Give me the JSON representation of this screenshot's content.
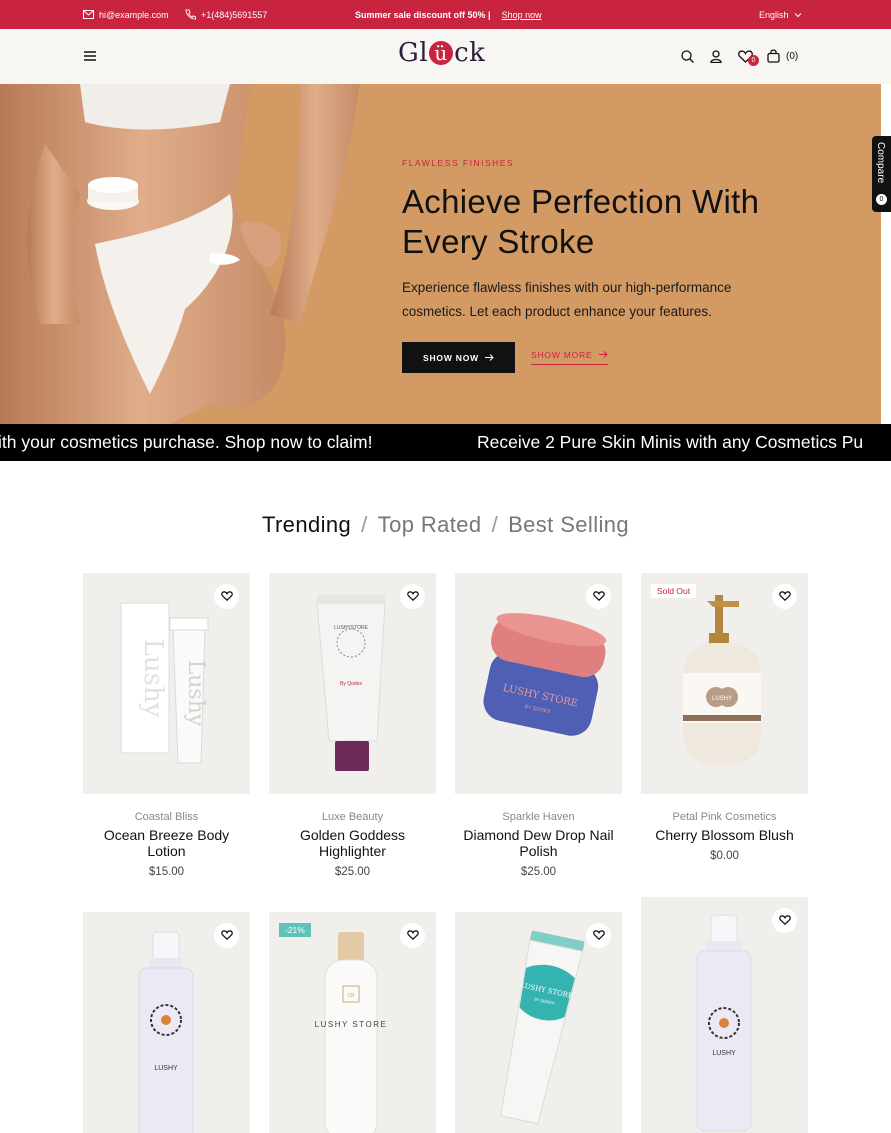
{
  "topbar": {
    "email": "hi@example.com",
    "phone": "+1(484)5691557",
    "promo": "Summer sale discount off 50% |",
    "promo_link": "Shop now",
    "language": "English"
  },
  "header": {
    "logo_left": "Gl",
    "logo_u": "ü",
    "logo_right": "ck",
    "wishlist_count": "0",
    "cart_count": "(0)"
  },
  "hero": {
    "eyebrow": "FLAWLESS FINISHES",
    "title": "Achieve Perfection With Every Stroke",
    "description": "Experience flawless finishes with our high-performance cosmetics. Let each product enhance your features.",
    "primary_button": "SHOW NOW",
    "secondary_button": "SHOW MORE"
  },
  "compare": {
    "label": "Compare",
    "count": "0"
  },
  "marquee": {
    "text_1": "ith your cosmetics purchase. Shop now to claim!",
    "text_2": "Receive 2 Pure Skin Minis with any Cosmetics Pu"
  },
  "tabs": [
    {
      "label": "Trending",
      "active": true
    },
    {
      "label": "Top Rated",
      "active": false
    },
    {
      "label": "Best Selling",
      "active": false
    }
  ],
  "products": [
    {
      "brand": "Coastal Bliss",
      "name": "Ocean Breeze Body Lotion",
      "price": "$15.00",
      "badge": ""
    },
    {
      "brand": "Luxe Beauty",
      "name": "Golden Goddess Highlighter",
      "price": "$25.00",
      "badge": ""
    },
    {
      "brand": "Sparkle Haven",
      "name": "Diamond Dew Drop Nail Polish",
      "price": "$25.00",
      "badge": ""
    },
    {
      "brand": "Petal Pink Cosmetics",
      "name": "Cherry Blossom Blush",
      "price": "$0.00",
      "badge": "Sold Out"
    },
    {
      "brand": "",
      "name": "",
      "price": "",
      "badge": ""
    },
    {
      "brand": "",
      "name": "",
      "price": "",
      "badge": "-21%"
    },
    {
      "brand": "",
      "name": "",
      "price": "",
      "badge": ""
    },
    {
      "brand": "",
      "name": "",
      "price": "",
      "badge": ""
    }
  ],
  "product_labels": {
    "tube_1": "Lushy",
    "tube_2": "Lushy",
    "highlighter": "LUSHYSTORE",
    "highlighter_sub": "By Qodex",
    "jar": "LUSHY STORE",
    "jar_sub": "BY QODEX",
    "pump": "LUSHY",
    "spray": "LUSHY",
    "bottle": "LUSHY STORE",
    "bottle_cap": "CB",
    "tube_teal": "LUSHY STORE",
    "tube_teal_sub": "BY QODEX"
  },
  "colors": {
    "accent": "#c8233f",
    "hero_bg": "#d49a63",
    "dark": "#111111",
    "card_bg": "#f1efec",
    "discount_badge": "#5ec4b8"
  },
  "icons": [
    "mail-icon",
    "phone-icon",
    "chevron-down-icon",
    "menu-icon",
    "search-icon",
    "user-icon",
    "heart-icon",
    "bag-icon",
    "arrow-right-icon"
  ]
}
